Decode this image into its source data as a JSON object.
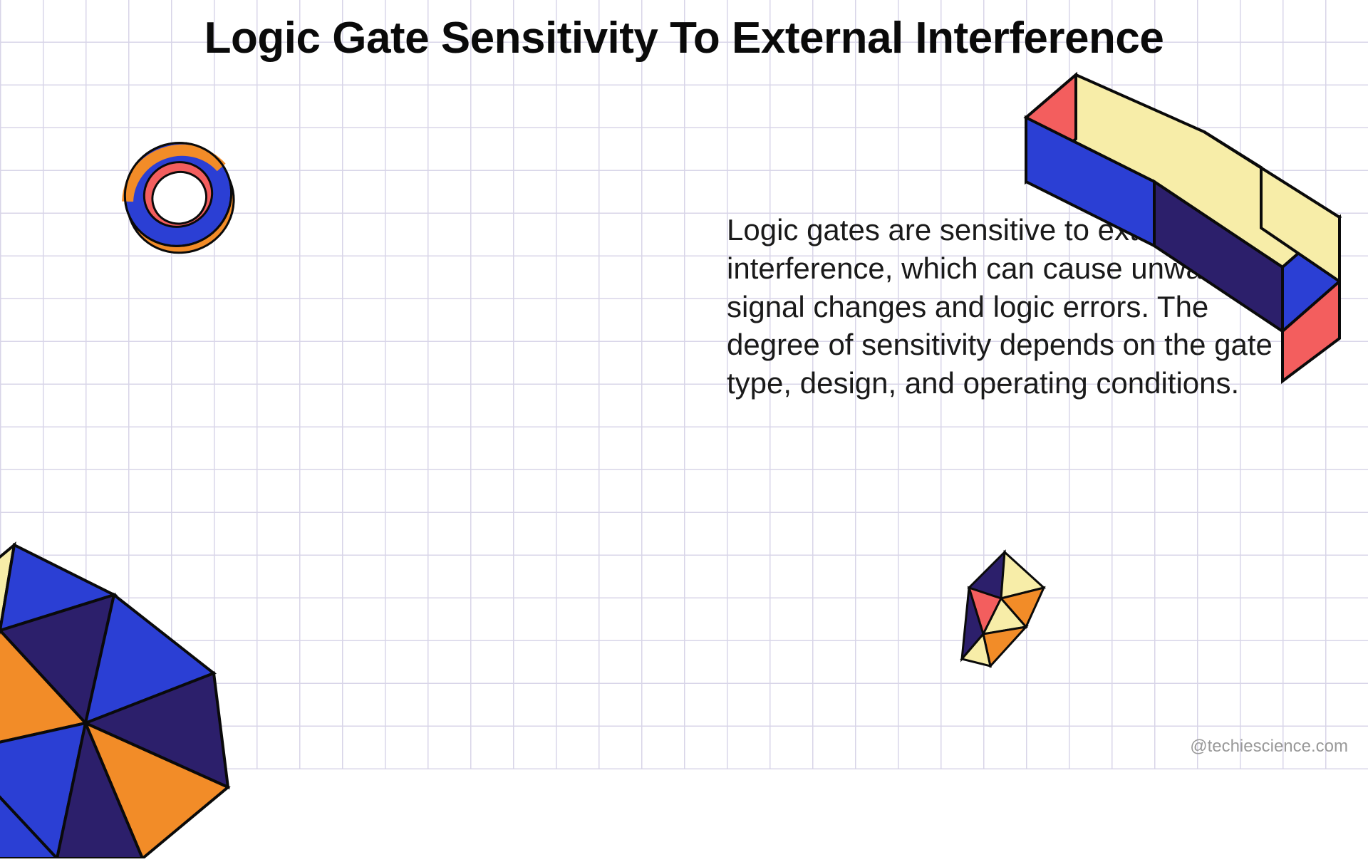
{
  "title": "Logic Gate Sensitivity To External Interference",
  "body": "Logic gates are sensitive to external interference, which can cause unwanted signal changes and logic errors. The degree of sensitivity depends on the gate type, design, and operating conditions.",
  "attribution": "@techiescience.com",
  "colors": {
    "orange": "#F28C28",
    "blue": "#2B3FD4",
    "darkPurple": "#2C1F6B",
    "coral": "#F35E5E",
    "cream": "#F7EDA8",
    "stroke": "#0a0a0a"
  }
}
